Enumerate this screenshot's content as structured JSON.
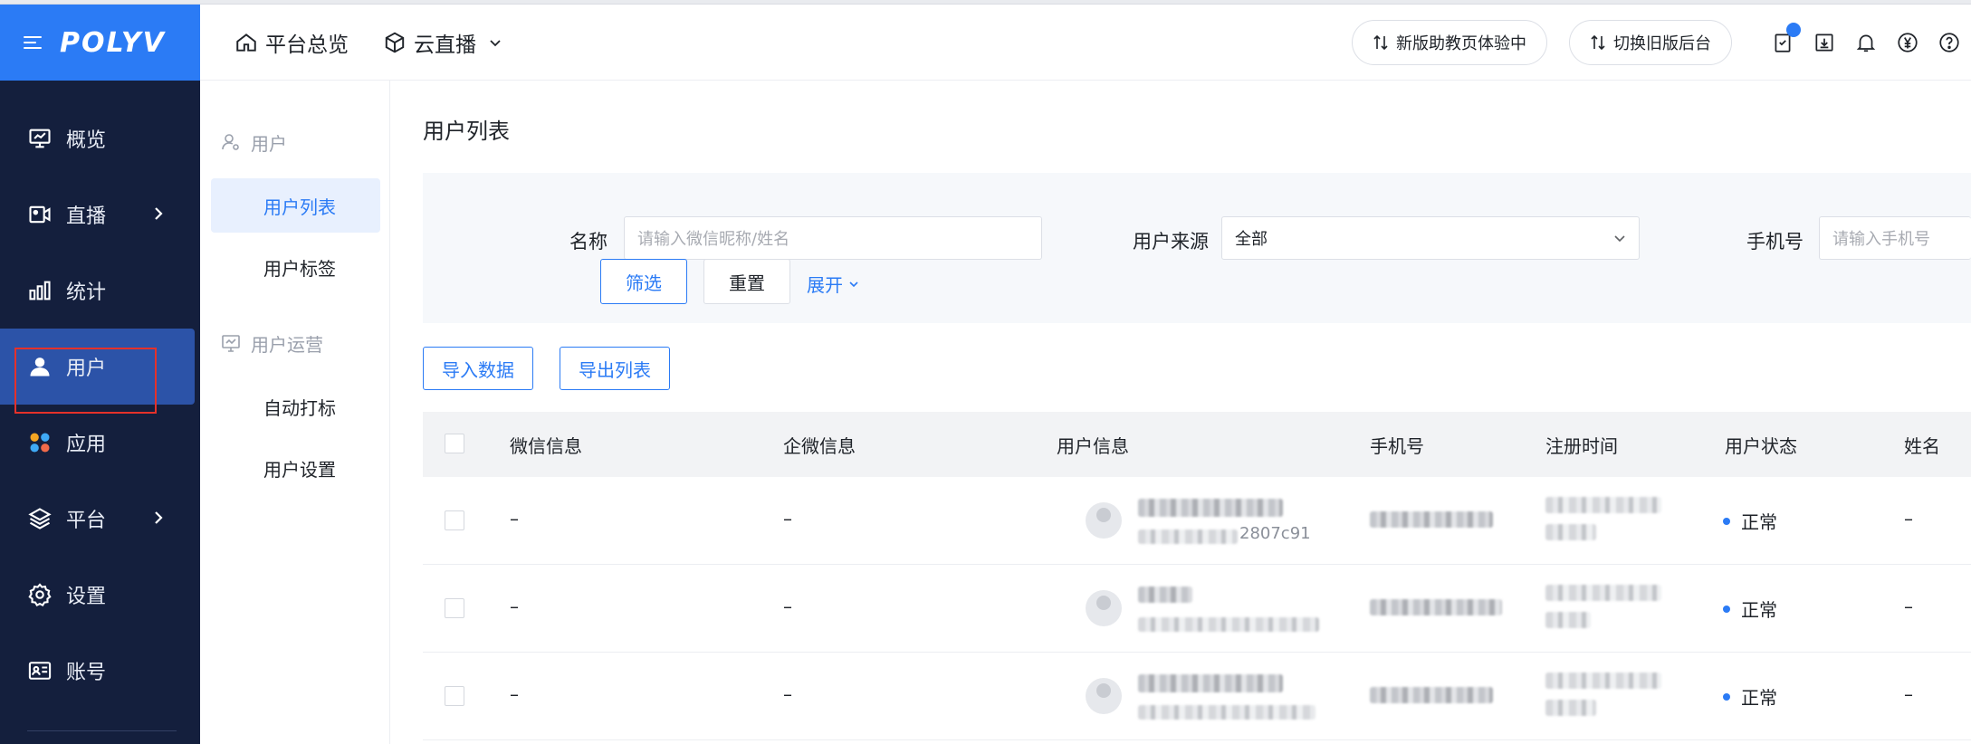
{
  "brand": {
    "logo": "POLYV"
  },
  "sidebar": {
    "items": [
      {
        "label": "概览",
        "icon": "monitor-icon"
      },
      {
        "label": "直播",
        "icon": "video-camera-icon",
        "has_arrow": true
      },
      {
        "label": "统计",
        "icon": "bar-chart-icon"
      },
      {
        "label": "用户",
        "icon": "user-icon",
        "active": true
      },
      {
        "label": "应用",
        "icon": "apps-icon"
      },
      {
        "label": "平台",
        "icon": "layers-icon",
        "has_arrow": true
      },
      {
        "label": "设置",
        "icon": "gear-icon"
      },
      {
        "label": "账号",
        "icon": "id-card-icon"
      }
    ]
  },
  "header": {
    "overview": "平台总览",
    "product": "云直播",
    "btn_new_assistant": "新版助教页体验中",
    "btn_switch_old": "切换旧版后台"
  },
  "subnav": {
    "group1": "用户",
    "items1": [
      "用户列表",
      "用户标签"
    ],
    "group2": "用户运营",
    "items2": [
      "自动打标",
      "用户设置"
    ]
  },
  "page": {
    "title": "用户列表"
  },
  "filter": {
    "name_label": "名称",
    "name_placeholder": "请输入微信昵称/姓名",
    "source_label": "用户来源",
    "source_value": "全部",
    "phone_label": "手机号",
    "phone_placeholder": "请输入手机号",
    "filter_btn": "筛选",
    "reset_btn": "重置",
    "expand": "展开"
  },
  "actions": {
    "import": "导入数据",
    "export": "导出列表"
  },
  "table": {
    "columns": [
      "微信信息",
      "企微信息",
      "用户信息",
      "手机号",
      "注册时间",
      "用户状态",
      "姓名"
    ],
    "rows": [
      {
        "wechat": "–",
        "wework": "–",
        "status": "正常",
        "name": "–",
        "partial_id": "2807c91"
      },
      {
        "wechat": "–",
        "wework": "–",
        "status": "正常",
        "name": "–"
      },
      {
        "wechat": "–",
        "wework": "–",
        "status": "正常",
        "name": "–"
      }
    ]
  },
  "colors": {
    "primary": "#2b7bf5",
    "sidebar_bg": "#141f3d",
    "highlight": "#e5312a"
  }
}
